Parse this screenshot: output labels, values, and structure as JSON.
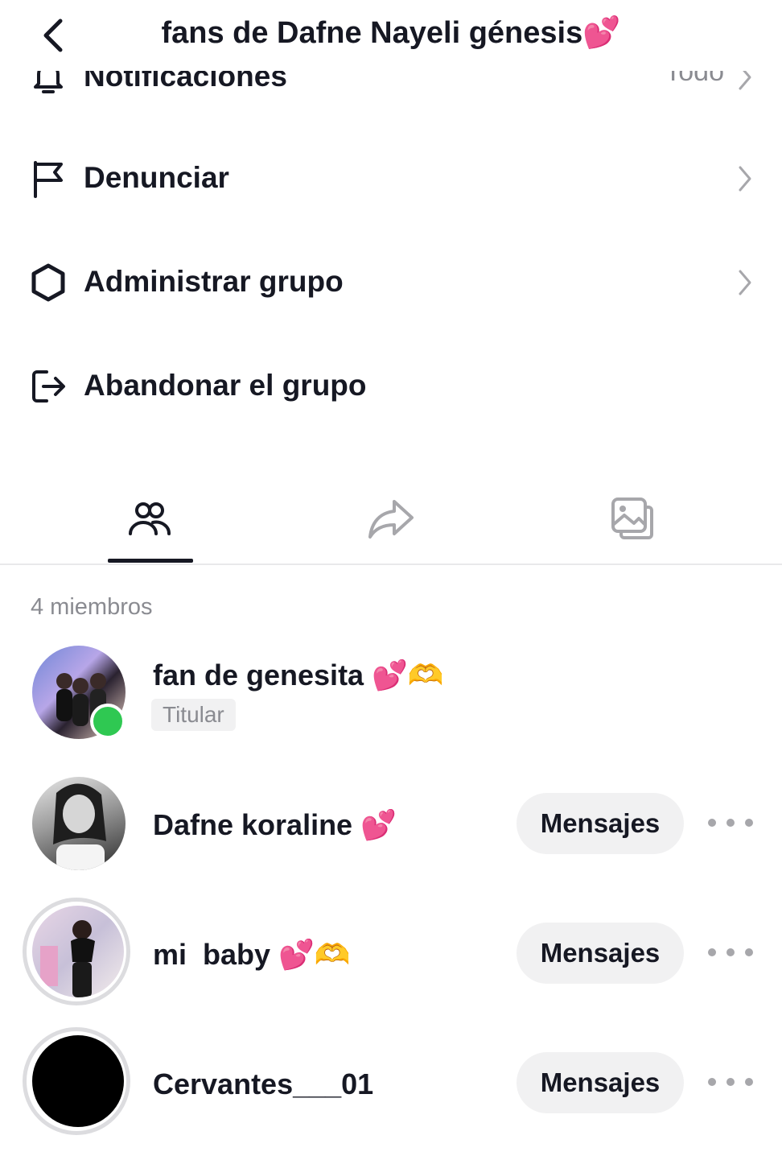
{
  "header": {
    "title": "fans de Dafne Nayeli génesis",
    "title_emoji": "💕"
  },
  "settings": {
    "notifications": {
      "label": "Notificaciones",
      "value": "Todo"
    },
    "report": {
      "label": "Denunciar"
    },
    "manage": {
      "label": "Administrar grupo"
    },
    "leave": {
      "label": "Abandonar el grupo"
    }
  },
  "tabs": [
    {
      "name": "members-icon",
      "active": true
    },
    {
      "name": "share-icon",
      "active": false
    },
    {
      "name": "gallery-icon",
      "active": false
    }
  ],
  "members_count": "4 miembros",
  "members": [
    {
      "name": "fan de genesita",
      "emoji_pink": "💕",
      "emoji_yellow": "🫶",
      "badge": "Titular",
      "online": true
    },
    {
      "name": "Dafne koraline",
      "emoji_pink": "💕",
      "button": "Mensajes"
    },
    {
      "name": "mi  baby",
      "emoji_pink": "💕",
      "emoji_yellow": "🫶",
      "button": "Mensajes"
    },
    {
      "name": "Cervantes___01",
      "button": "Mensajes"
    }
  ],
  "colors": {
    "online": "#2fc852",
    "text": "#161823",
    "muted": "#8a8b91",
    "button_bg": "#f1f1f2"
  }
}
